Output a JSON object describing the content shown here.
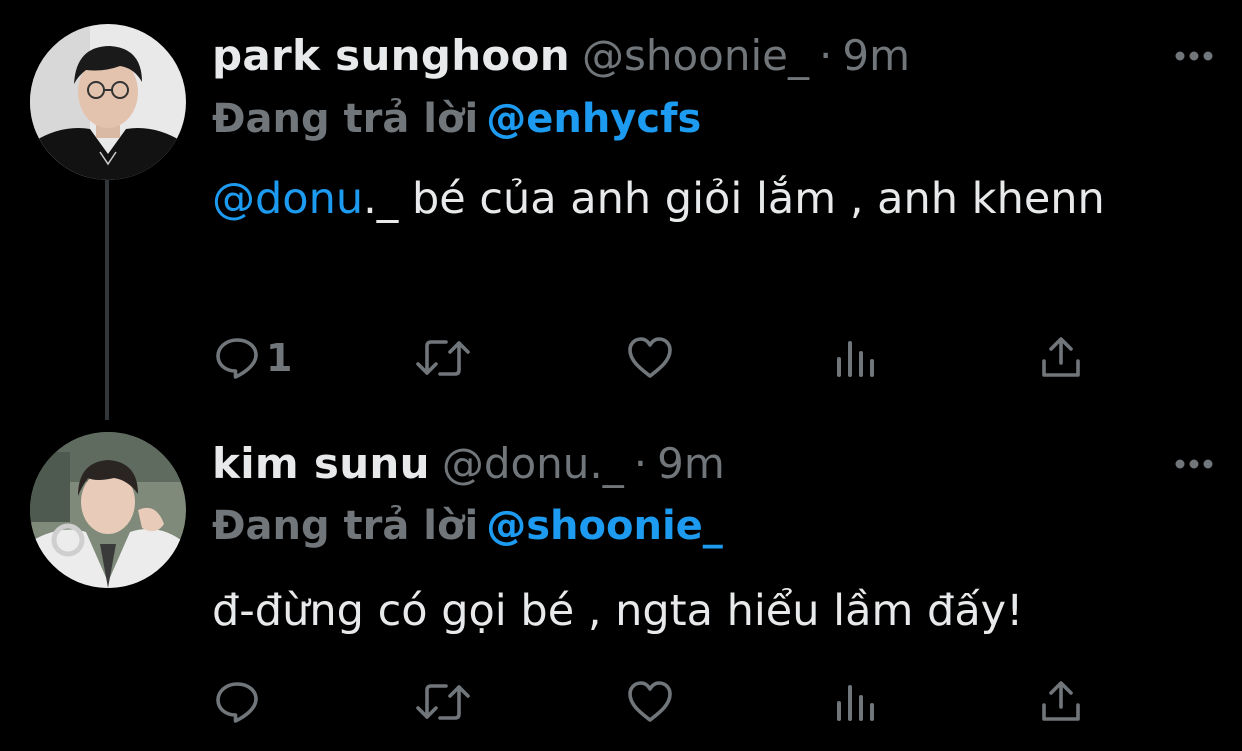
{
  "colors": {
    "background": "#000000",
    "text_primary": "#e7e9ea",
    "text_secondary": "#71767b",
    "accent": "#1d9bf0"
  },
  "tweets": [
    {
      "display_name": "park sunghoon",
      "handle": "@shoonie_",
      "separator": "·",
      "time": "9m",
      "reply_label": "Đang trả lời",
      "reply_to": "@enhycfs",
      "text_mention": "@donu",
      "text_body": "._ bé của anh giỏi lắm , anh khenn",
      "reply_count": "1",
      "icons": [
        "more-icon",
        "reply-icon",
        "retweet-icon",
        "like-icon",
        "views-icon",
        "share-icon"
      ]
    },
    {
      "display_name": "kim sunu",
      "handle": "@donu._",
      "separator": "·",
      "time": "9m",
      "reply_label": "Đang trả lời",
      "reply_to": "@shoonie_",
      "text_body": "đ-đừng có gọi bé , ngta hiểu lầm đấy!",
      "reply_count": "",
      "icons": [
        "more-icon",
        "reply-icon",
        "retweet-icon",
        "like-icon",
        "views-icon",
        "share-icon"
      ]
    }
  ]
}
